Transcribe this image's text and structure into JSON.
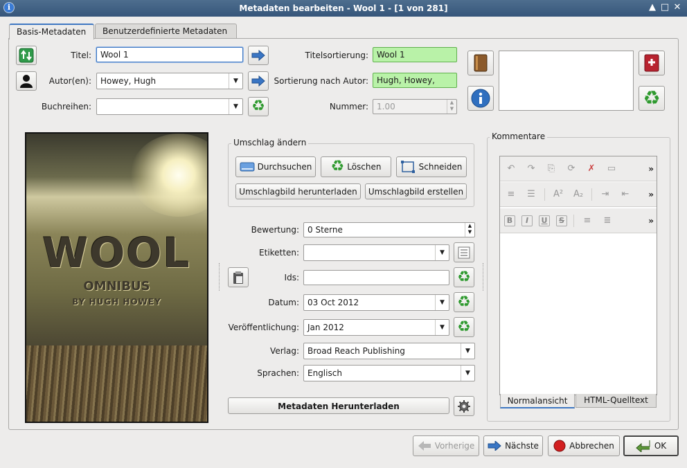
{
  "window": {
    "title": "Metadaten bearbeiten - Wool 1 -  [1 von 281]",
    "app_icon_glyph": "i",
    "btn_up": "▲",
    "btn_max": "□",
    "btn_close": "✕"
  },
  "tabs": [
    "Basis-Metadaten",
    "Benutzerdefinierte Metadaten"
  ],
  "fields": {
    "title_label": "Titel:",
    "title_value": "Wool 1",
    "author_label": "Autor(en):",
    "author_value": "Howey, Hugh",
    "series_label": "Buchreihen:",
    "series_value": "",
    "title_sort_label": "Titelsortierung:",
    "title_sort_value": "Wool 1",
    "author_sort_label": "Sortierung nach Autor:",
    "author_sort_value": "Hugh, Howey,",
    "number_label": "Nummer:",
    "number_value": "1.00"
  },
  "cover_group": {
    "title": "Umschlag ändern",
    "browse": "Durchsuchen",
    "delete": "Löschen",
    "trim": "Schneiden",
    "download": "Umschlagbild herunterladen",
    "generate": "Umschlagbild erstellen"
  },
  "cover_image": {
    "title": "WOOL",
    "subtitle": "OMNIBUS",
    "author": "BY HUGH HOWEY"
  },
  "details": {
    "rating_label": "Bewertung:",
    "rating_value": "0 Sterne",
    "tags_label": "Etiketten:",
    "tags_value": "",
    "ids_label": "Ids:",
    "ids_value": "",
    "date_label": "Datum:",
    "date_value": "03 Oct 2012",
    "published_label": "Veröffentlichung:",
    "published_value": "Jan 2012",
    "publisher_label": "Verlag:",
    "publisher_value": "Broad Reach Publishing",
    "languages_label": "Sprachen:",
    "languages_value": "Englisch",
    "download_metadata": "Metadaten Herunterladen"
  },
  "comments": {
    "title": "Kommentare",
    "tab_normal": "Normalansicht",
    "tab_html": "HTML-Quelltext",
    "toolbar_more": "»"
  },
  "footer": {
    "prev": "Vorherige",
    "next": "Nächste",
    "cancel": "Abbrechen",
    "ok": "OK"
  }
}
